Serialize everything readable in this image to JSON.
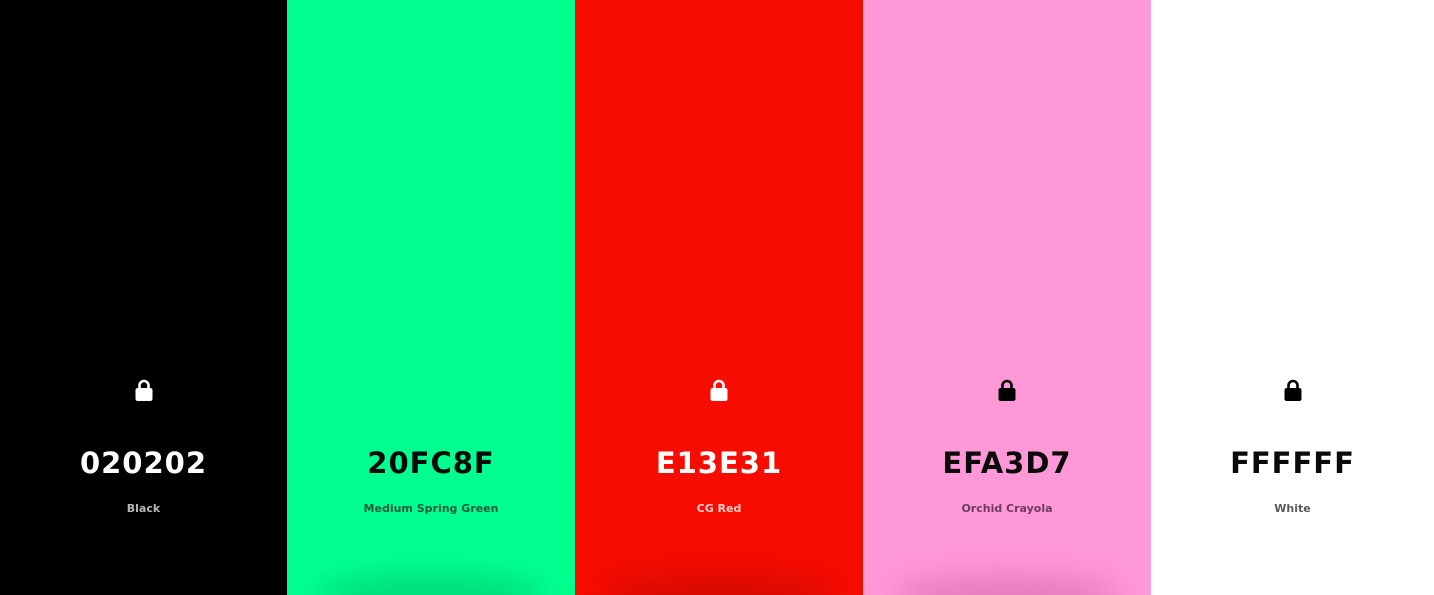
{
  "palette": {
    "swatches": [
      {
        "hex": "020202",
        "name": "Black",
        "background": "#000000",
        "text_color": "#ffffff",
        "name_color": "#b8b8b8",
        "icon": "lock-icon",
        "icon_color": "#ffffff",
        "shadow_color": "#000000"
      },
      {
        "hex": "20FC8F",
        "name": "Medium Spring Green",
        "background": "#00ff8f",
        "text_color": "#0a0a0a",
        "name_color": "#1e5a3c",
        "icon": "lock-icon",
        "icon_color": "#00ff8f",
        "shadow_color": "#009a55"
      },
      {
        "hex": "E13E31",
        "name": "CG Red",
        "background": "#f60c00",
        "text_color": "#ffffff",
        "name_color": "#fbd1cd",
        "icon": "lock-icon",
        "icon_color": "#ffffff",
        "shadow_color": "#9a0800"
      },
      {
        "hex": "EFA3D7",
        "name": "Orchid Crayola",
        "background": "#ff98d7",
        "text_color": "#0a0a0a",
        "name_color": "#6a3d5a",
        "icon": "lock-icon",
        "icon_color": "#000000",
        "shadow_color": "#b2478f"
      },
      {
        "hex": "FFFFFF",
        "name": "White",
        "background": "#ffffff",
        "text_color": "#0a0a0a",
        "name_color": "#5a5a5a",
        "icon": "lock-icon",
        "icon_color": "#000000",
        "shadow_color": "#ffffff"
      }
    ]
  }
}
